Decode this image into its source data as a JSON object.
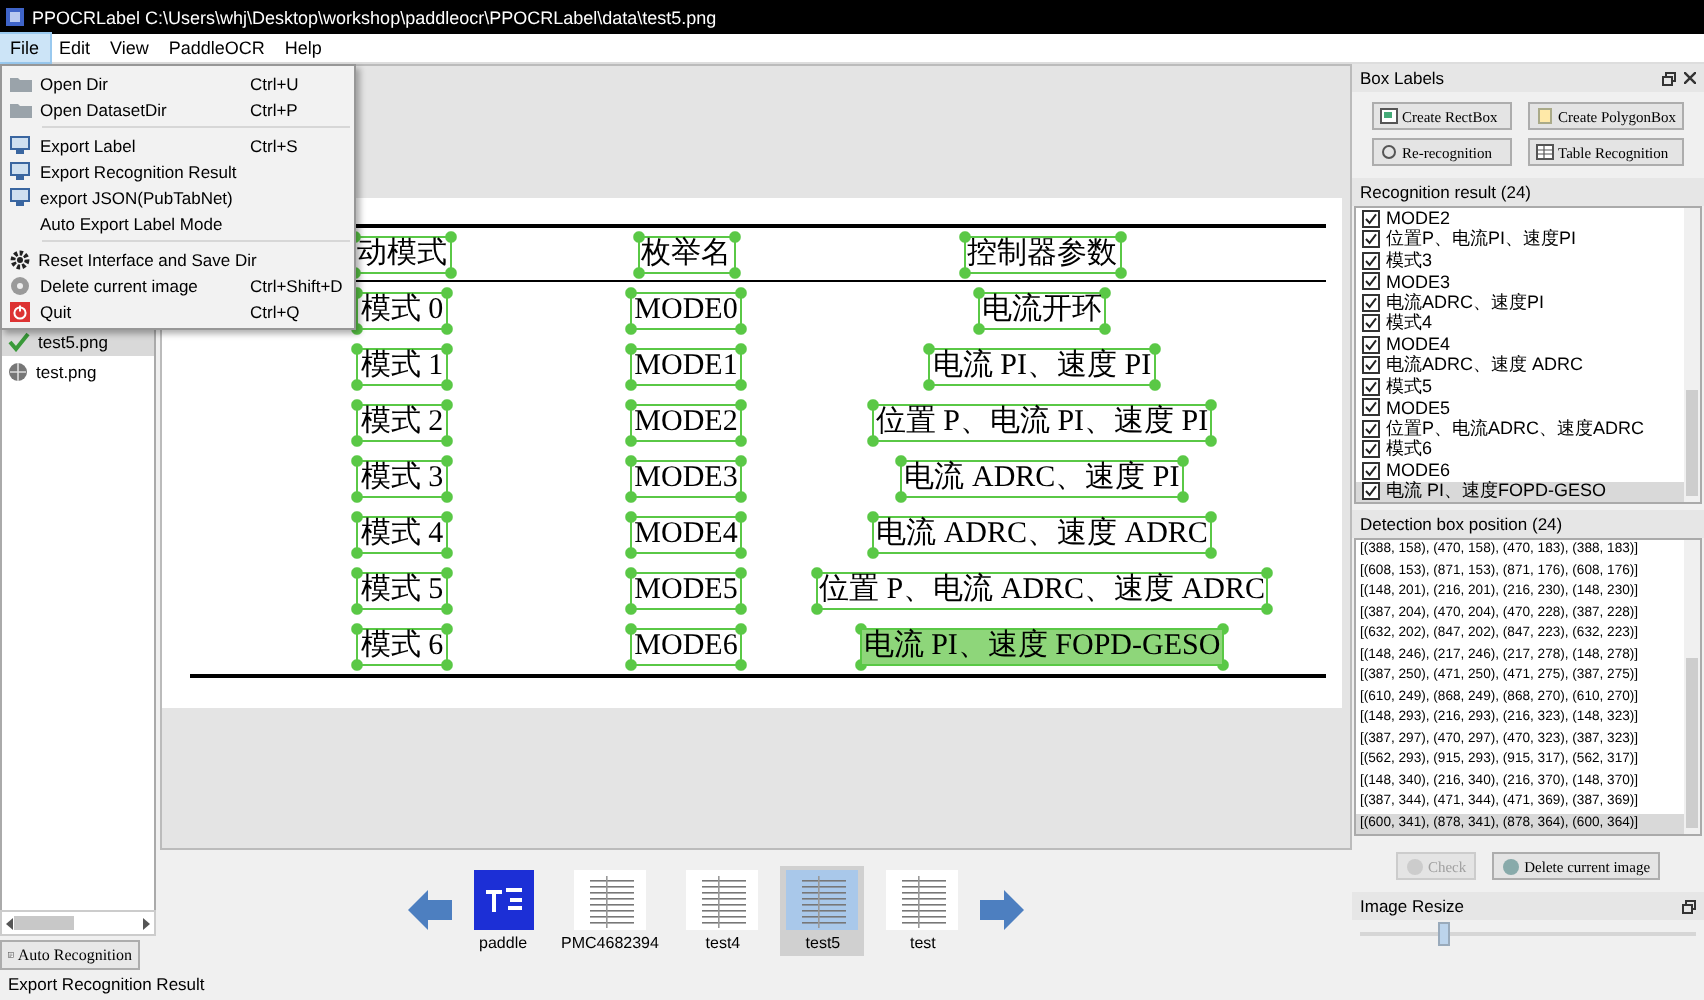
{
  "window": {
    "title": "PPOCRLabel C:\\Users\\whj\\Desktop\\workshop\\paddleocr\\PPOCRLabel\\data\\test5.png"
  },
  "menu_bar": [
    {
      "label": "File",
      "selected": true
    },
    {
      "label": "Edit",
      "selected": false
    },
    {
      "label": "View",
      "selected": false
    },
    {
      "label": "PaddleOCR",
      "selected": false
    },
    {
      "label": "Help",
      "selected": false
    }
  ],
  "file_menu": [
    {
      "kind": "action",
      "label": "Open Dir",
      "shortcut": "Ctrl+U"
    },
    {
      "kind": "action",
      "label": "Open DatasetDir",
      "shortcut": "Ctrl+P"
    },
    {
      "kind": "separator"
    },
    {
      "kind": "action",
      "label": "Export Label",
      "shortcut": "Ctrl+S"
    },
    {
      "kind": "action",
      "label": "Export Recognition Result"
    },
    {
      "kind": "action",
      "label": "export JSON(PubTabNet)"
    },
    {
      "kind": "check",
      "label": "Auto Export Label Mode",
      "checked": false
    },
    {
      "kind": "separator"
    },
    {
      "kind": "action",
      "label": "Reset Interface and Save Dir"
    },
    {
      "kind": "action",
      "label": "Delete current image",
      "shortcut": "Ctrl+Shift+D"
    },
    {
      "kind": "action",
      "label": "Quit",
      "shortcut": "Ctrl+Q"
    }
  ],
  "file_list": [
    {
      "name": "test5.png",
      "checked": true,
      "selected": true
    },
    {
      "name": "test.png",
      "checked": false,
      "selected": false
    }
  ],
  "auto_recognition_button": "Auto Recognition",
  "canvas": {
    "header": [
      {
        "text": "动模式",
        "selected": false
      },
      {
        "text": "枚举名",
        "selected": false
      },
      {
        "text": "控制器参数",
        "selected": false
      }
    ],
    "rows": [
      [
        {
          "text": "模式 0",
          "selected": false
        },
        {
          "text": "MODE0",
          "selected": false
        },
        {
          "text": "电流开环",
          "selected": false
        }
      ],
      [
        {
          "text": "模式 1",
          "selected": false
        },
        {
          "text": "MODE1",
          "selected": false
        },
        {
          "text": "电流 PI、速度 PI",
          "selected": false
        }
      ],
      [
        {
          "text": "模式 2",
          "selected": false
        },
        {
          "text": "MODE2",
          "selected": false
        },
        {
          "text": "位置 P、电流 PI、速度 PI",
          "selected": false
        }
      ],
      [
        {
          "text": "模式 3",
          "selected": false
        },
        {
          "text": "MODE3",
          "selected": false
        },
        {
          "text": "电流 ADRC、速度 PI",
          "selected": false
        }
      ],
      [
        {
          "text": "模式 4",
          "selected": false
        },
        {
          "text": "MODE4",
          "selected": false
        },
        {
          "text": "电流 ADRC、速度 ADRC",
          "selected": false
        }
      ],
      [
        {
          "text": "模式 5",
          "selected": false
        },
        {
          "text": "MODE5",
          "selected": false
        },
        {
          "text": "位置 P、电流 ADRC、速度 ADRC",
          "selected": false
        }
      ],
      [
        {
          "text": "模式 6",
          "selected": false
        },
        {
          "text": "MODE6",
          "selected": false
        },
        {
          "text": "电流 PI、速度 FOPD-GESO",
          "selected": true
        }
      ]
    ]
  },
  "thumbnails": [
    {
      "label": "paddle",
      "selected": false
    },
    {
      "label": "PMC4682394",
      "selected": false
    },
    {
      "label": "test4",
      "selected": false
    },
    {
      "label": "test5",
      "selected": true
    },
    {
      "label": "test",
      "selected": false
    }
  ],
  "box_labels": {
    "title": "Box Labels",
    "buttons": [
      "Create RectBox",
      "Create PolygonBox",
      "Re-recognition",
      "Table Recognition"
    ]
  },
  "recognition_result": {
    "title": "Recognition result (24)",
    "items": [
      {
        "text": "MODE2",
        "checked": true,
        "selected": false
      },
      {
        "text": "位置P、电流PI、速度PI",
        "checked": true,
        "selected": false
      },
      {
        "text": "模式3",
        "checked": true,
        "selected": false
      },
      {
        "text": "MODE3",
        "checked": true,
        "selected": false
      },
      {
        "text": "电流ADRC、速度PI",
        "checked": true,
        "selected": false
      },
      {
        "text": "模式4",
        "checked": true,
        "selected": false
      },
      {
        "text": "MODE4",
        "checked": true,
        "selected": false
      },
      {
        "text": "电流ADRC、速度 ADRC",
        "checked": true,
        "selected": false
      },
      {
        "text": "模式5",
        "checked": true,
        "selected": false
      },
      {
        "text": "MODE5",
        "checked": true,
        "selected": false
      },
      {
        "text": "位置P、电流ADRC、速度ADRC",
        "checked": true,
        "selected": false
      },
      {
        "text": "模式6",
        "checked": true,
        "selected": false
      },
      {
        "text": "MODE6",
        "checked": true,
        "selected": false
      },
      {
        "text": "电流 PI、速度FOPD-GESO",
        "checked": true,
        "selected": true
      }
    ]
  },
  "detection_box_position": {
    "title": "Detection box position (24)",
    "items": [
      {
        "text": "[(388, 158), (470, 158), (470, 183), (388, 183)]",
        "selected": false
      },
      {
        "text": "[(608, 153), (871, 153), (871, 176), (608, 176)]",
        "selected": false
      },
      {
        "text": "[(148, 201), (216, 201), (216, 230), (148, 230)]",
        "selected": false
      },
      {
        "text": "[(387, 204), (470, 204), (470, 228), (387, 228)]",
        "selected": false
      },
      {
        "text": "[(632, 202), (847, 202), (847, 223), (632, 223)]",
        "selected": false
      },
      {
        "text": "[(148, 246), (217, 246), (217, 278), (148, 278)]",
        "selected": false
      },
      {
        "text": "[(387, 250), (471, 250), (471, 275), (387, 275)]",
        "selected": false
      },
      {
        "text": "[(610, 249), (868, 249), (868, 270), (610, 270)]",
        "selected": false
      },
      {
        "text": "[(148, 293), (216, 293), (216, 323), (148, 323)]",
        "selected": false
      },
      {
        "text": "[(387, 297), (470, 297), (470, 323), (387, 323)]",
        "selected": false
      },
      {
        "text": "[(562, 293), (915, 293), (915, 317), (562, 317)]",
        "selected": false
      },
      {
        "text": "[(148, 340), (216, 340), (216, 370), (148, 370)]",
        "selected": false
      },
      {
        "text": "[(387, 344), (471, 344), (471, 369), (387, 369)]",
        "selected": false
      },
      {
        "text": "[(600, 341), (878, 341), (878, 364), (600, 364)]",
        "selected": true
      }
    ]
  },
  "actions": [
    {
      "label": "Check",
      "disabled": true
    },
    {
      "label": "Delete current image",
      "disabled": false
    }
  ],
  "image_resize": {
    "title": "Image Resize",
    "level": 0.25
  },
  "status_bar": "Export Recognition Result"
}
